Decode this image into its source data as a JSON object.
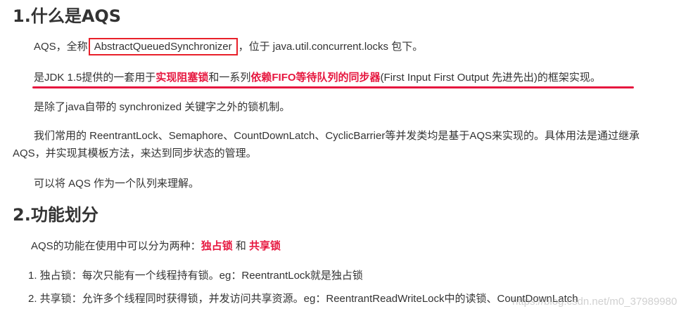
{
  "section1": {
    "heading": "1.什么是AQS",
    "p1": {
      "before": "AQS，全称",
      "boxed": "AbstractQueuedSynchronizer",
      "after": "，位于 java.util.concurrent.locks 包下。"
    },
    "p2": {
      "part1": "是JDK 1.5提供的一套用于",
      "hl1": "实现阻塞锁",
      "part2": "和一系列",
      "hl2": "依赖FIFO等待队列的同步器",
      "part3": "(First Input First Output   先进先出)的框架实现。"
    },
    "p3": "是除了java自带的 synchronized 关键字之外的锁机制。",
    "p4_line1": "我们常用的 ReentrantLock、Semaphore、CountDownLatch、CyclicBarrier等并发类均是基于AQS来实现的。具体用法是通过继承",
    "p4_line2": "AQS，并实现其模板方法，来达到同步状态的管理。",
    "p5": "可以将 AQS 作为一个队列来理解。"
  },
  "section2": {
    "heading": "2.功能划分",
    "intro": {
      "before": "AQS的功能在使用中可以分为两种：",
      "hl1": "独占锁",
      "middle": " 和 ",
      "hl2": "共享锁"
    },
    "items": [
      "1. 独占锁：每次只能有一个线程持有锁。eg：ReentrantLock就是独占锁",
      "2. 共享锁：允许多个线程同时获得锁，并发访问共享资源。eg：ReentrantReadWriteLock中的读锁、CountDownLatch"
    ]
  },
  "watermark": "https://blog.csdn.net/m0_37989980",
  "colors": {
    "text": "#333333",
    "highlight": "#e6173f",
    "box_border": "#e8202a"
  }
}
